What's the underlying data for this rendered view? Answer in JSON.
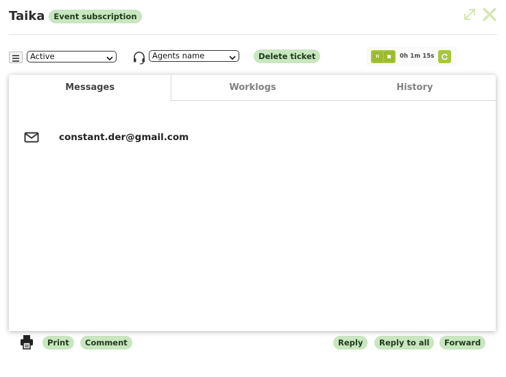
{
  "header": {
    "title": "Taika",
    "badge": "Event subscription",
    "expand_icon": "expand-arrows-icon",
    "close_icon": "close-x-icon"
  },
  "toolbar": {
    "menu_icon": "list-menu-icon",
    "status_select": {
      "value": "Active",
      "options_visible": [
        "Active"
      ]
    },
    "agent_icon": "headset-icon",
    "agent_select": {
      "value": "Agents name"
    },
    "delete_label": "Delete ticket"
  },
  "timer": {
    "pause_label": "II",
    "stop_label": "■",
    "elapsed": "0h 1m 15s",
    "refresh_icon": "refresh-icon"
  },
  "tabs": [
    {
      "label": "Messages",
      "active": true
    },
    {
      "label": "Worklogs",
      "active": false
    },
    {
      "label": "History",
      "active": false
    }
  ],
  "messages": [
    {
      "icon": "envelope-icon",
      "from": "constant.der@gmail.com"
    }
  ],
  "footer": {
    "print_icon": "printer-icon",
    "print_label": "Print",
    "comment_label": "Comment",
    "reply_label": "Reply",
    "reply_all_label": "Reply to all",
    "forward_label": "Forward"
  },
  "colors": {
    "badge_bg": "#c8e6c0",
    "timer_green": "#a9c73a",
    "window_ctrl": "#d6e6b4"
  }
}
